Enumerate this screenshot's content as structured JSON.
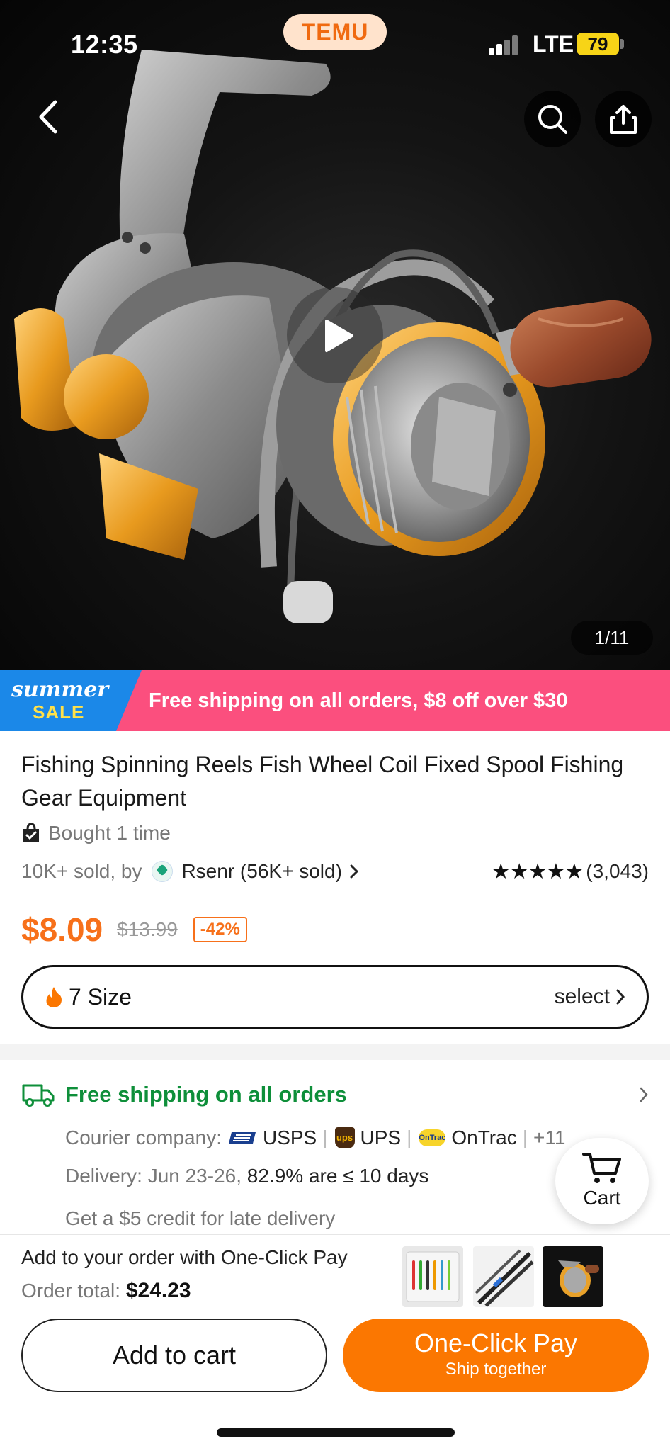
{
  "status_bar": {
    "time": "12:35",
    "network": "LTE",
    "battery": "79"
  },
  "brand_badge": "TEMU",
  "hero": {
    "image_counter": "1/11"
  },
  "promo": {
    "badge_line1": "summer",
    "badge_line2": "SALE",
    "text": "Free shipping on all orders, $8 off over $30"
  },
  "product": {
    "title": "Fishing Spinning Reels Fish Wheel Coil Fixed Spool Fishing Gear Equipment",
    "bought": "Bought 1 time",
    "sold_prefix": "10K+ sold, by",
    "seller": "Rsenr (56K+ sold)",
    "rating_value": 4.5,
    "review_count": "(3,043)",
    "price": "$8.09",
    "original_price": "$13.99",
    "discount": "-42%",
    "size_option": "7 Size",
    "size_select": "select"
  },
  "shipping": {
    "headline": "Free shipping on all orders",
    "courier_label": "Courier company:",
    "couriers": [
      "USPS",
      "UPS",
      "OnTrac"
    ],
    "courier_more": "+11",
    "delivery_label": "Delivery: Jun 23-26,",
    "delivery_stat": "82.9% are ≤ 10 days",
    "late_credit": "Get a $5 credit for late delivery"
  },
  "cart_fab": {
    "label": "Cart"
  },
  "bottom_bar": {
    "one_click_text": "Add to your order with One-Click Pay",
    "order_total_label": "Order total:",
    "order_total_value": "$24.23",
    "add_to_cart": "Add to cart",
    "one_click_pay": "One-Click Pay",
    "ship_together": "Ship together"
  },
  "colors": {
    "accent_orange": "#fb7701",
    "price_orange": "#f7701a",
    "promo_pink": "#fb4f7e",
    "promo_blue": "#1b88e8",
    "free_ship_green": "#0e8f3a"
  },
  "icons": [
    "back-icon",
    "search-icon",
    "share-icon",
    "play-icon",
    "bag-check-icon",
    "chevron-right-icon",
    "fire-icon",
    "truck-icon",
    "cart-icon"
  ]
}
